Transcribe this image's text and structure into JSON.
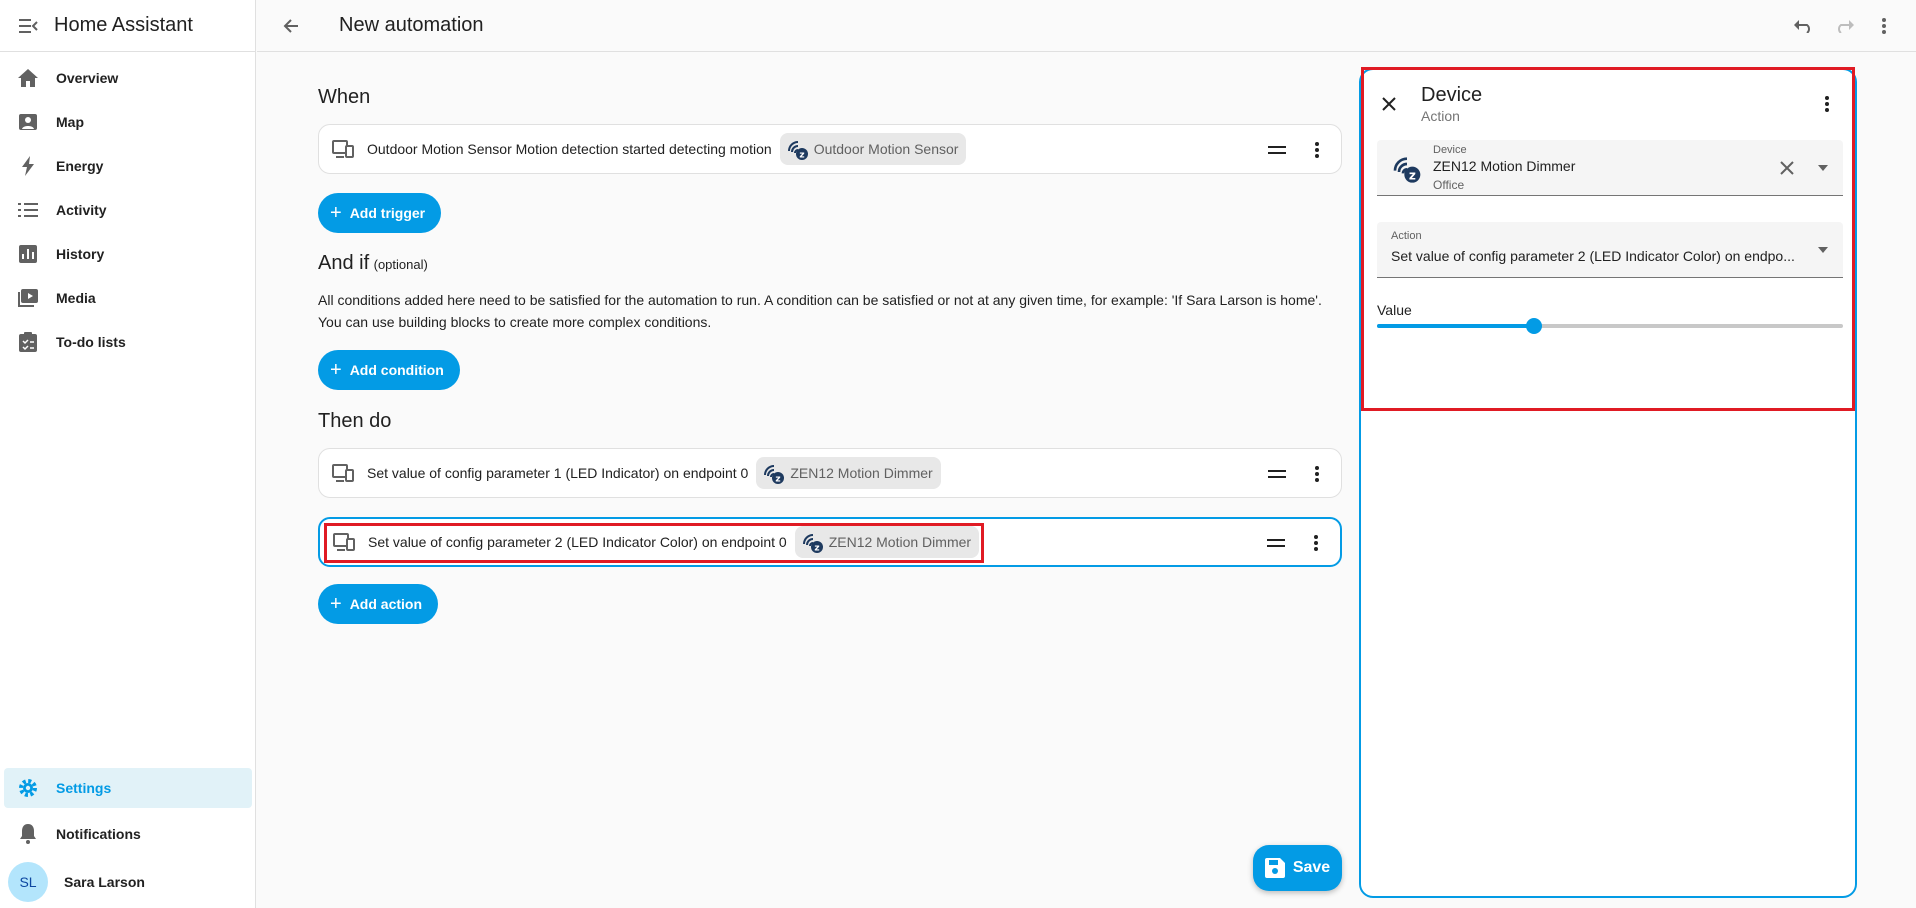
{
  "app": {
    "title": "Home Assistant",
    "page_title": "New automation"
  },
  "sidebar": {
    "items": [
      {
        "label": "Overview",
        "icon": "home-icon"
      },
      {
        "label": "Map",
        "icon": "map-icon"
      },
      {
        "label": "Energy",
        "icon": "lightning-icon"
      },
      {
        "label": "Activity",
        "icon": "list-icon"
      },
      {
        "label": "History",
        "icon": "chart-icon"
      },
      {
        "label": "Media",
        "icon": "media-icon"
      },
      {
        "label": "To-do lists",
        "icon": "clipboard-icon"
      }
    ],
    "settings_label": "Settings",
    "notifications_label": "Notifications",
    "user": {
      "initials": "SL",
      "name": "Sara Larson"
    }
  },
  "when": {
    "title": "When",
    "trigger_text": "Outdoor Motion Sensor Motion detection started detecting motion",
    "trigger_chip": "Outdoor Motion Sensor",
    "add_label": "Add trigger"
  },
  "and_if": {
    "title": "And if",
    "optional": "(optional)",
    "description_1": "All conditions added here need to be satisfied for the automation to run. A condition can be satisfied or not at any given time, for example: 'If Sara Larson is home'.",
    "description_2": "You can use building blocks to create more complex conditions.",
    "add_label": "Add condition"
  },
  "then_do": {
    "title": "Then do",
    "actions": [
      {
        "text": "Set value of config parameter 1 (LED Indicator) on endpoint 0",
        "chip": "ZEN12 Motion Dimmer"
      },
      {
        "text": "Set value of config parameter 2 (LED Indicator Color) on endpoint 0",
        "chip": "ZEN12 Motion Dimmer"
      }
    ],
    "add_label": "Add action"
  },
  "panel": {
    "title": "Device",
    "subtitle": "Action",
    "device_field": {
      "label": "Device",
      "value": "ZEN12 Motion Dimmer",
      "sub": "Office"
    },
    "action_field": {
      "label": "Action",
      "value": "Set value of config parameter 2 (LED Indicator Color) on endpo..."
    },
    "value_label": "Value",
    "slider_fraction": 0.336
  },
  "save_label": "Save",
  "colors": {
    "accent": "#039be5",
    "highlight": "#e01b24"
  }
}
